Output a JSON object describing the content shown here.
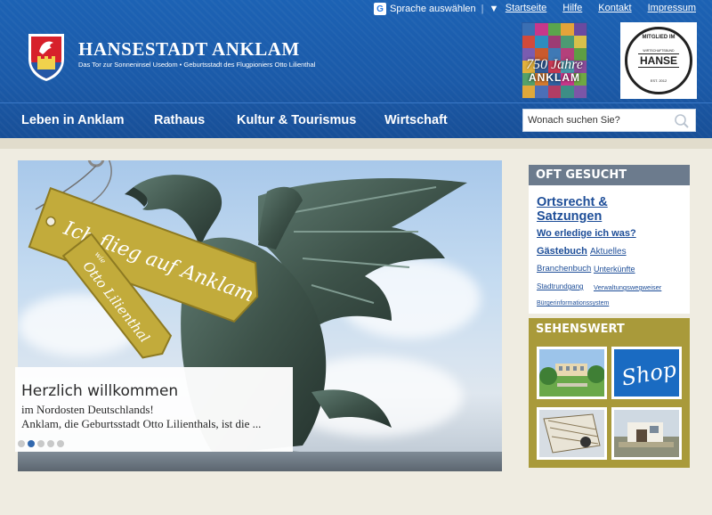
{
  "header": {
    "language_label": "Sprache auswählen",
    "language_arrow": "▼",
    "top_links": [
      "Startseite",
      "Hilfe",
      "Kontakt",
      "Impressum"
    ],
    "site_title": "HANSESTADT ANKLAM",
    "site_subtitle": "Das Tor zur Sonneninsel Usedom  •  Geburtsstadt des Flugpioniers Otto Lilienthal",
    "badge_750_script": "750 Jahre",
    "badge_750_word": "ANKLAM",
    "hanse_ring_top": "MITGLIED IM",
    "hanse_ring_sub": "WIRTSCHAFTSBUND",
    "hanse_word": "HANSE",
    "hanse_ring_bottom": "EST. 2012"
  },
  "nav": {
    "items": [
      "Leben in Anklam",
      "Rathaus",
      "Kultur & Tourismus",
      "Wirtschaft"
    ],
    "search_placeholder": "Wonach suchen Sie?"
  },
  "hero": {
    "tag_main": "Ich flieg auf Anklam",
    "tag_small_prefix": "wie",
    "tag_small": "Otto Lilienthal",
    "welcome_title": "Herzlich willkommen",
    "welcome_line1": "im Nordosten Deutschlands!",
    "welcome_line2": "Anklam, die Geburtsstadt Otto Lilienthals, ist die ...",
    "slide_count": 5,
    "active_slide": 2
  },
  "sidebar": {
    "oft_gesucht_title": "OFT GESUCHT",
    "links": {
      "ortsrecht": "Ortsrecht & Satzungen",
      "wo_erledige": "Wo erledige ich was?",
      "gaestebuch": "Gästebuch",
      "aktuelles": "Aktuelles",
      "branchenbuch": "Branchenbuch",
      "unterkuenfte": "Unterkünfte",
      "stadtrundgang": "Stadtrundgang",
      "verwaltungswegweiser": "Verwaltungswegweiser",
      "buergerinfo": "Bürgerinformationssystem"
    },
    "sehenswert_title": "SEHENSWERT",
    "shop_label": "Shop"
  },
  "colors": {
    "header_blue": "#1b5aa8",
    "link_blue": "#1e4e98",
    "gray_head": "#6c7b8d",
    "olive": "#a99a3a",
    "tag_gold": "#c2ab3b"
  }
}
